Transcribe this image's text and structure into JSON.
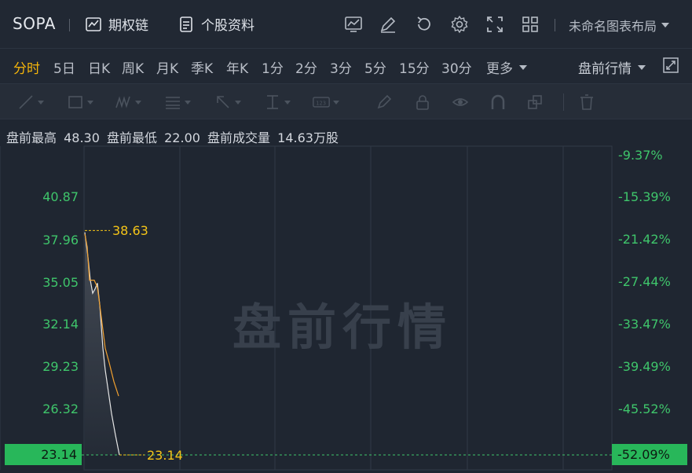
{
  "header": {
    "ticker": "SOPA",
    "options_chain": "期权链",
    "profile": "个股资料",
    "layout": "未命名图表布局"
  },
  "icons": [
    "chart-icon",
    "edit-icon",
    "refresh-icon",
    "gear-icon",
    "fullscreen-icon",
    "grid-icon"
  ],
  "periods": {
    "p1": "分时",
    "p2": "5日",
    "p3": "日K",
    "p4": "周K",
    "p5": "月K",
    "p6": "季K",
    "p7": "年K",
    "p8": "1分",
    "p9": "2分",
    "p10": "3分",
    "p11": "5分",
    "p12": "15分",
    "p13": "30分",
    "p14": "更多",
    "active": "分时",
    "session": "盘前行情"
  },
  "info": {
    "high_label": "盘前最高",
    "high": "48.30",
    "low_label": "盘前最低",
    "low": "22.00",
    "vol_label": "盘前成交量",
    "vol": "14.63万股"
  },
  "chart_data": {
    "type": "line",
    "y_ticks": [
      "40.87",
      "37.96",
      "35.05",
      "32.14",
      "29.23",
      "26.32",
      "23.14"
    ],
    "pct_ticks": [
      "-9.37%",
      "-15.39%",
      "-21.42%",
      "-27.44%",
      "-33.47%",
      "-39.49%",
      "-45.52%",
      "-52.09%"
    ],
    "ylim": [
      23.14,
      43.8
    ],
    "series": [
      {
        "values": [
          38.5,
          36.8,
          35.2,
          34.3,
          34.6,
          35.0,
          33.5,
          32.0,
          30.5,
          29.0,
          27.5,
          26.0,
          24.5,
          23.14
        ]
      },
      {
        "values": [
          38.4,
          37.5,
          35.2,
          35.2,
          35.2,
          34.7,
          33.5,
          32.2,
          30.5,
          29.5,
          28.2,
          27.2
        ]
      }
    ],
    "high_marker": "38.63",
    "last_marker": "23.14",
    "last_left": "23.14",
    "last_right": "-52.09%",
    "watermark": "盘前行情",
    "line_color": "#e6e6e6",
    "avg_color": "#f0a030",
    "axis_color": "#3fc56b",
    "marker_color": "#f5c518"
  }
}
